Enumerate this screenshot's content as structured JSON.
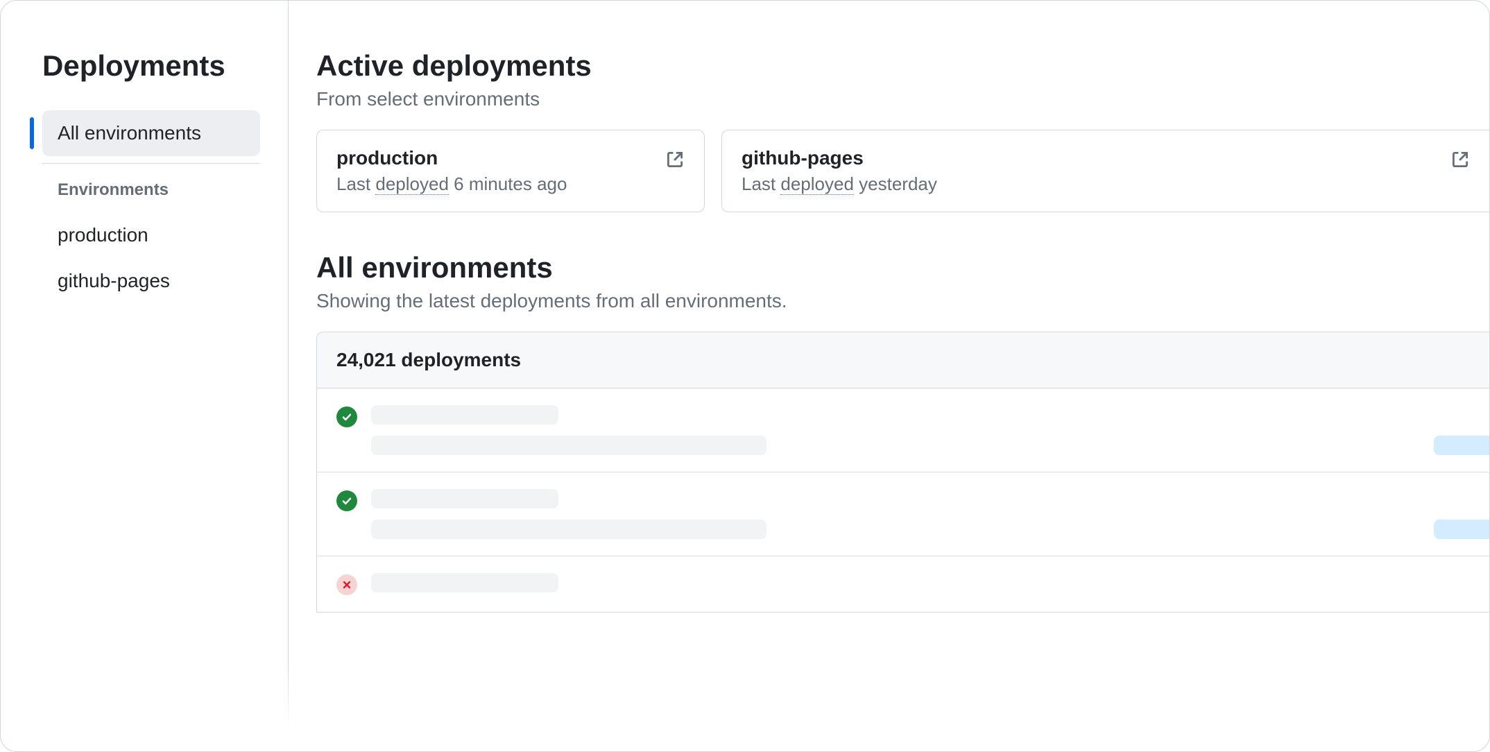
{
  "sidebar": {
    "title": "Deployments",
    "active_item": "All environments",
    "sub_heading": "Environments",
    "items": [
      {
        "label": "production"
      },
      {
        "label": "github-pages"
      }
    ]
  },
  "active": {
    "title": "Active deployments",
    "subtitle": "From select environments",
    "cards": [
      {
        "name": "production",
        "last_prefix": "Last ",
        "last_action": "deployed",
        "last_suffix": " 6 minutes ago"
      },
      {
        "name": "github-pages",
        "last_prefix": "Last ",
        "last_action": "deployed",
        "last_suffix": " yesterday"
      }
    ]
  },
  "all": {
    "title": "All environments",
    "subtitle": "Showing the latest deployments from all environments.",
    "count_label": "24,021 deployments",
    "rows": [
      {
        "status": "success"
      },
      {
        "status": "success"
      },
      {
        "status": "fail"
      }
    ]
  }
}
